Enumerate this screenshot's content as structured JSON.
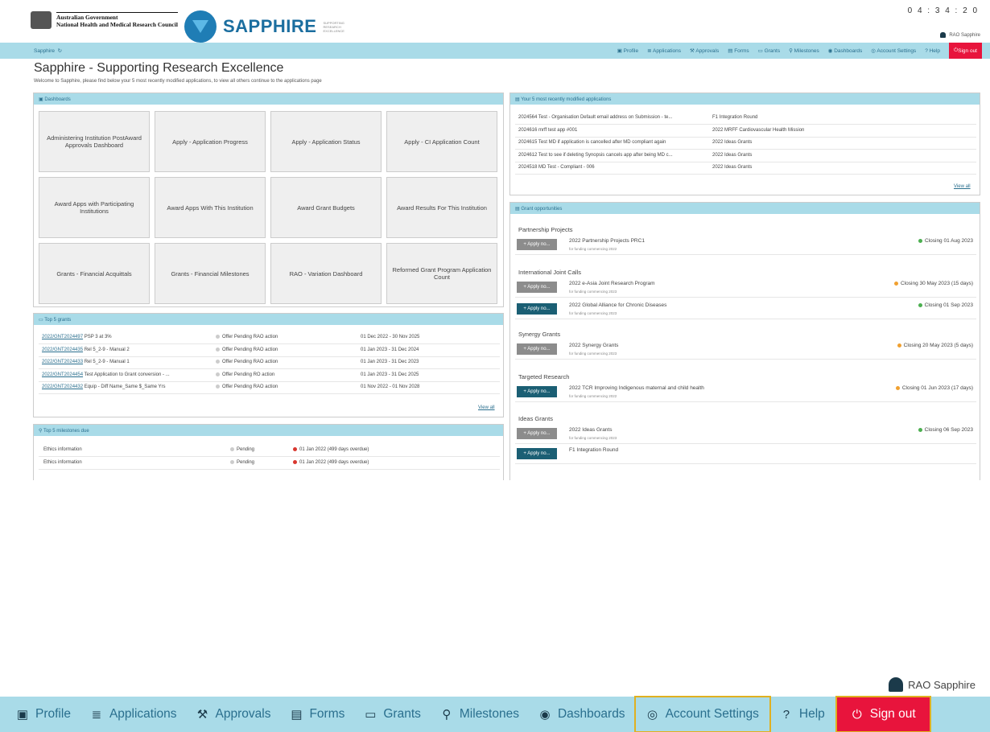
{
  "header": {
    "gov_line1": "Australian Government",
    "gov_line2": "National Health and Medical Research Council",
    "app_name": "SAPPHIRE",
    "tagline": "SUPPORTING RESEARCH EXCELLENCE",
    "clock": "0 4 : 3 4 : 2 0",
    "user": "RAO Sapphire"
  },
  "nav": {
    "brand": "Sapphire",
    "items": [
      "Profile",
      "Applications",
      "Approvals",
      "Forms",
      "Grants",
      "Milestones",
      "Dashboards",
      "Account Settings",
      "Help"
    ],
    "signout": "Sign out"
  },
  "page": {
    "title": "Sapphire - Supporting Research Excellence",
    "welcome": "Welcome to Sapphire, please find below your 5 most recently modified applications, to view all others continue to the applications page"
  },
  "dashboards": {
    "title": "Dashboards",
    "tiles": [
      "Administering Institution PostAward Approvals Dashboard",
      "Apply - Application Progress",
      "Apply - Application Status",
      "Apply - CI Application Count",
      "Award Apps with Participating Institutions",
      "Award Apps With This Institution",
      "Award Grant Budgets",
      "Award Results For This Institution",
      "Grants - Financial Acquittals",
      "Grants - Financial Milestones",
      "RAO - Variation Dashboard",
      "Reformed Grant Program Application Count"
    ]
  },
  "grants": {
    "title": "Top 5 grants",
    "rows": [
      {
        "id": "2022/GNT2024497",
        "name": "PSP 3 at 3%",
        "status": "Offer Pending RAO action",
        "dates": "01 Dec 2022 - 30 Nov 2025"
      },
      {
        "id": "2022/GNT2024435",
        "name": "Rel 5_2-9 - Manual 2",
        "status": "Offer Pending RAO action",
        "dates": "01 Jan 2023 - 31 Dec 2024"
      },
      {
        "id": "2022/GNT2024433",
        "name": "Rel 5_2-9 - Manual 1",
        "status": "Offer Pending RAO action",
        "dates": "01 Jan 2023 - 31 Dec 2023"
      },
      {
        "id": "2022/GNT2024454",
        "name": "Test Application to Grant conversion - ...",
        "status": "Offer Pending RO action",
        "dates": "01 Jan 2023 - 31 Dec 2025"
      },
      {
        "id": "2022/GNT2024432",
        "name": "Equip - Diff Name_Same $_Same Yrs",
        "status": "Offer Pending RAO action",
        "dates": "01 Nov 2022 - 01 Nov 2028"
      }
    ],
    "view_all": "View all"
  },
  "milestones": {
    "title": "Top 5 milestones due",
    "rows": [
      {
        "name": "Ethics information",
        "status": "Pending",
        "due": "01 Jan 2022 (499 days overdue)"
      },
      {
        "name": "Ethics information",
        "status": "Pending",
        "due": "01 Jan 2022 (499 days overdue)"
      }
    ]
  },
  "recent": {
    "title": "Your 5 most recently modified applications",
    "rows": [
      {
        "id": "2024564",
        "name": "Test - Organisation Default email address on Submission - te...",
        "round": "F1 Integration Round"
      },
      {
        "id": "2024616",
        "name": "mrff test app #001",
        "round": "2022 MRFF Cardiovascular Health Mission"
      },
      {
        "id": "2024615",
        "name": "Test MD if application is cancelled after MD compliant again",
        "round": "2022 Ideas Grants"
      },
      {
        "id": "2024612",
        "name": "Test to see if deleting Synopsis cancels app after being MD c...",
        "round": "2022 Ideas Grants"
      },
      {
        "id": "2024518",
        "name": "MD Test - Compliant - 006",
        "round": "2022 Ideas Grants"
      }
    ],
    "view_all": "View all"
  },
  "opportunities": {
    "title": "Grant opportunities",
    "apply_label": "+ Apply no...",
    "categories": [
      {
        "name": "Partnership Projects",
        "items": [
          {
            "name": "2022 Partnership Projects PRC1",
            "sub": "for funding commencing 2022",
            "closing": "Closing 01 Aug 2023",
            "state": "grey",
            "dot": "green"
          }
        ]
      },
      {
        "name": "International Joint Calls",
        "items": [
          {
            "name": "2022 e-Asia Joint Research Program",
            "sub": "for funding commencing 2023",
            "closing": "Closing 30 May 2023 (15 days)",
            "state": "grey",
            "dot": "orange"
          },
          {
            "name": "2022 Global Alliance for Chronic Diseases",
            "sub": "for funding commencing 2023",
            "closing": "Closing 01 Sep 2023",
            "state": "teal",
            "dot": "green"
          }
        ]
      },
      {
        "name": "Synergy Grants",
        "items": [
          {
            "name": "2022 Synergy Grants",
            "sub": "for funding commencing 2023",
            "closing": "Closing 20 May 2023 (5 days)",
            "state": "grey",
            "dot": "orange"
          }
        ]
      },
      {
        "name": "Targeted Research",
        "items": [
          {
            "name": "2022 TCR Improving Indigenous maternal and child health",
            "sub": "for funding commencing 2022",
            "closing": "Closing 01 Jun 2023 (17 days)",
            "state": "teal",
            "dot": "orange"
          }
        ]
      },
      {
        "name": "Ideas Grants",
        "items": [
          {
            "name": "2022 Ideas Grants",
            "sub": "for funding commencing 2023",
            "closing": "Closing 06 Sep 2023",
            "state": "grey",
            "dot": "green"
          },
          {
            "name": "F1 Integration Round",
            "sub": "",
            "closing": "",
            "state": "teal",
            "dot": ""
          }
        ]
      }
    ]
  },
  "zoom": {
    "user": "RAO Sapphire",
    "items": [
      "Profile",
      "Applications",
      "Approvals",
      "Forms",
      "Grants",
      "Milestones",
      "Dashboards",
      "Account Settings",
      "Help"
    ],
    "signout": "Sign out"
  },
  "colors": {
    "nav_bg": "#a9dbe8",
    "signout": "#e8143c",
    "highlight": "#e0b020",
    "accent": "#1b5f74"
  }
}
